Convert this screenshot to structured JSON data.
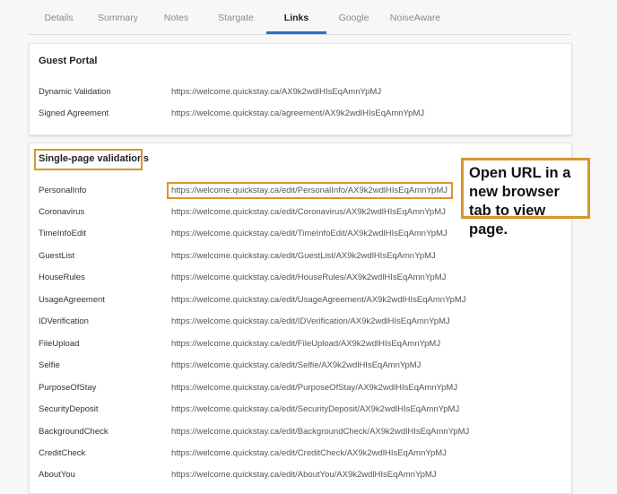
{
  "tabs": [
    "Details",
    "Summary",
    "Notes",
    "Stargate",
    "Links",
    "Google",
    "NoiseAware"
  ],
  "active_tab": "Links",
  "guest_portal": {
    "title": "Guest Portal",
    "rows": [
      {
        "label": "Dynamic Validation",
        "url": "https://welcome.quickstay.ca/AX9k2wdlHIsEqAmnYpMJ"
      },
      {
        "label": "Signed Agreement",
        "url": "https://welcome.quickstay.ca/agreement/AX9k2wdlHIsEqAmnYpMJ"
      }
    ]
  },
  "single_page": {
    "title": "Single-page validations",
    "rows": [
      {
        "label": "PersonalInfo",
        "url": "https://welcome.quickstay.ca/edit/PersonalInfo/AX9k2wdlHIsEqAmnYpMJ"
      },
      {
        "label": "Coronavirus",
        "url": "https://welcome.quickstay.ca/edit/Coronavirus/AX9k2wdlHIsEqAmnYpMJ"
      },
      {
        "label": "TimeInfoEdit",
        "url": "https://welcome.quickstay.ca/edit/TimeInfoEdit/AX9k2wdlHIsEqAmnYpMJ"
      },
      {
        "label": "GuestList",
        "url": "https://welcome.quickstay.ca/edit/GuestList/AX9k2wdlHIsEqAmnYpMJ"
      },
      {
        "label": "HouseRules",
        "url": "https://welcome.quickstay.ca/edit/HouseRules/AX9k2wdlHIsEqAmnYpMJ"
      },
      {
        "label": "UsageAgreement",
        "url": "https://welcome.quickstay.ca/edit/UsageAgreement/AX9k2wdlHIsEqAmnYpMJ"
      },
      {
        "label": "IDVerification",
        "url": "https://welcome.quickstay.ca/edit/IDVerification/AX9k2wdlHIsEqAmnYpMJ"
      },
      {
        "label": "FileUpload",
        "url": "https://welcome.quickstay.ca/edit/FileUpload/AX9k2wdlHIsEqAmnYpMJ"
      },
      {
        "label": "Selfie",
        "url": "https://welcome.quickstay.ca/edit/Selfie/AX9k2wdlHIsEqAmnYpMJ"
      },
      {
        "label": "PurposeOfStay",
        "url": "https://welcome.quickstay.ca/edit/PurposeOfStay/AX9k2wdlHIsEqAmnYpMJ"
      },
      {
        "label": "SecurityDeposit",
        "url": "https://welcome.quickstay.ca/edit/SecurityDeposit/AX9k2wdlHIsEqAmnYpMJ"
      },
      {
        "label": "BackgroundCheck",
        "url": "https://welcome.quickstay.ca/edit/BackgroundCheck/AX9k2wdlHIsEqAmnYpMJ"
      },
      {
        "label": "CreditCheck",
        "url": "https://welcome.quickstay.ca/edit/CreditCheck/AX9k2wdlHIsEqAmnYpMJ"
      },
      {
        "label": "AboutYou",
        "url": "https://welcome.quickstay.ca/edit/AboutYou/AX9k2wdlHIsEqAmnYpMJ"
      }
    ]
  },
  "callout_text": "Open URL in a new browser tab to view page.",
  "colors": {
    "accent": "#1e73c8",
    "highlight": "#d9962b"
  }
}
